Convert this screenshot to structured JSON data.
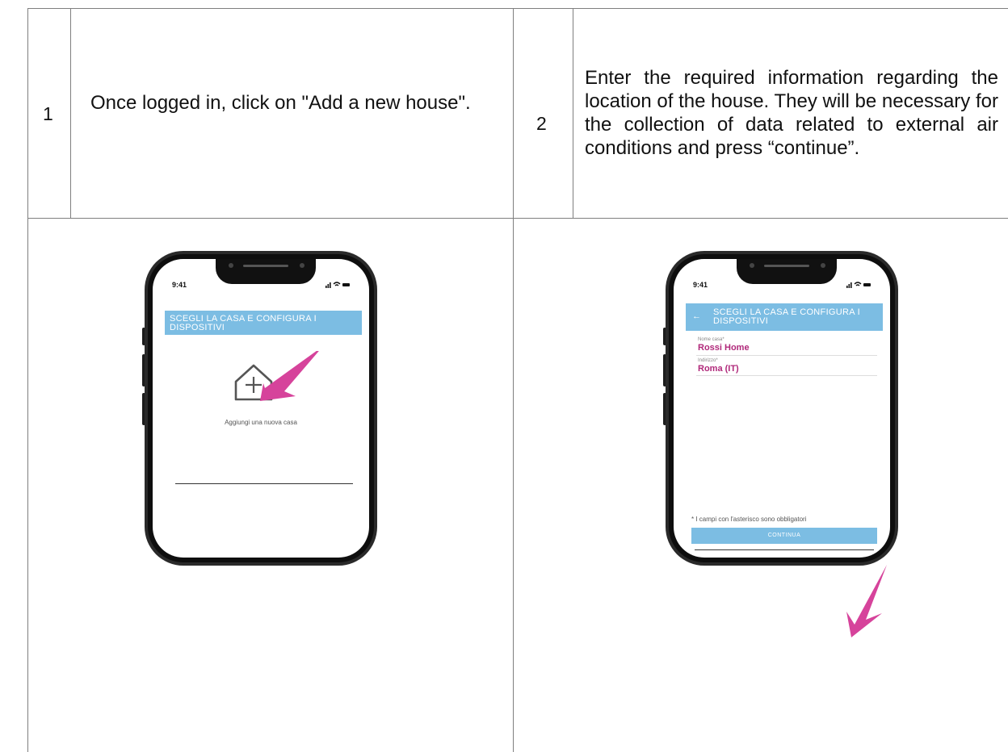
{
  "steps": [
    {
      "number": "1",
      "text": "Once logged in, click on \"Add a new house\"."
    },
    {
      "number": "2",
      "text": "Enter the required information regarding the location of the house. They will be necessary for the collection of data related to external air conditions and press “continue”."
    }
  ],
  "phone1": {
    "time": "9:41",
    "status_icons": "signal-wifi-battery",
    "header": "SCEGLI LA CASA E CONFIGURA I DISPOSITIVI",
    "add_house_label": "Aggiungi una nuova casa",
    "icon": "house-plus-icon"
  },
  "phone2": {
    "time": "9:41",
    "status_icons": "signal-wifi-battery",
    "header": "SCEGLI LA CASA E CONFIGURA I DISPOSITIVI",
    "back_icon": "arrow-left-icon",
    "fields": [
      {
        "label": "Nome casa*",
        "value": "Rossi Home"
      },
      {
        "label": "Indirizzo*",
        "value": "Roma (IT)"
      }
    ],
    "required_note": "* I campi con l'asterisco sono obbligatori",
    "continue_label": "CONTINUA"
  },
  "colors": {
    "accent": "#7cbde3",
    "arrow": "#d6439b",
    "value": "#b0287a"
  }
}
